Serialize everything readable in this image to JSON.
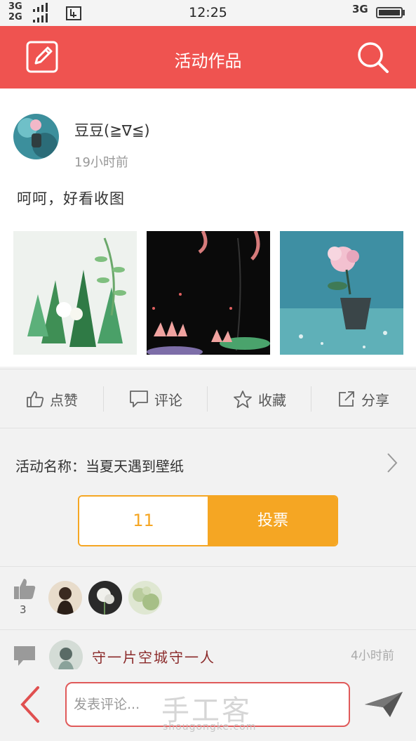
{
  "status_bar": {
    "net1": "3G",
    "net2": "2G",
    "time": "12:25",
    "net_right": "3G"
  },
  "header": {
    "title": "活动作品",
    "accent": "#ef5350"
  },
  "post": {
    "author": "豆豆(≧∇≦)",
    "time": "19小时前",
    "text": "呵呵，好看收图"
  },
  "actions": {
    "like": "点赞",
    "comment": "评论",
    "favorite": "收藏",
    "share": "分享"
  },
  "activity": {
    "name": "活动名称：当夏天遇到壁纸"
  },
  "vote": {
    "count": "11",
    "button": "投票",
    "color": "#f5a623"
  },
  "likes": {
    "count": "3"
  },
  "comment": {
    "user": "守一片空城守一人",
    "time": "4小时前"
  },
  "bottom": {
    "placeholder": "发表评论...",
    "watermark": "手工客",
    "watermark_url": "shougongke.com"
  },
  "icons": {
    "edit": "edit-icon",
    "search": "search-icon",
    "like": "thumbs-up-icon",
    "comment": "comment-icon",
    "favorite": "star-icon",
    "share": "share-icon",
    "chevron": "chevron-right-icon",
    "back": "back-arrow-icon",
    "send": "send-icon"
  }
}
